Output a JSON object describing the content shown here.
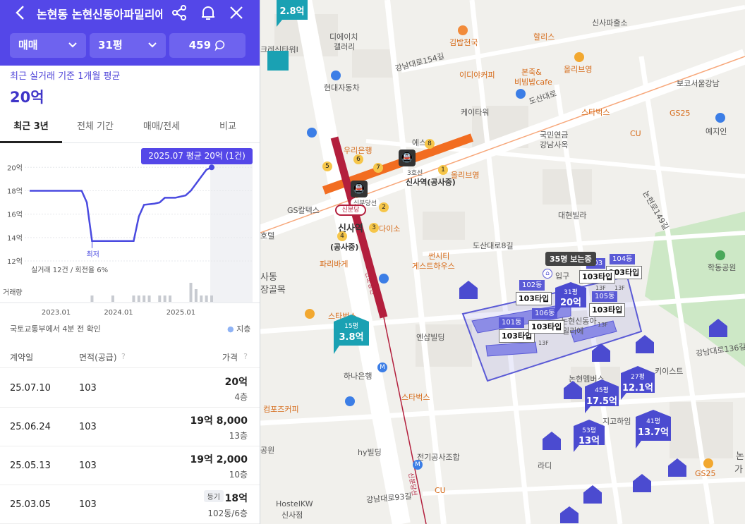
{
  "header": {
    "title": "논현동 논현신동아파밀리에",
    "back_icon": "chevron-left-icon",
    "share_icon": "share-icon",
    "alarm_icon": "bell-icon",
    "close_icon": "close-icon"
  },
  "filters": {
    "trade": "매매",
    "size": "31평",
    "comments": "459"
  },
  "summary": {
    "caption": "최근 실거래 기준 1개월 평균",
    "value": "20억"
  },
  "tabs": [
    "최근 3년",
    "전체 기간",
    "매매/전세",
    "비교"
  ],
  "chart_data": {
    "type": "line",
    "tooltip": "2025.07 평균 20억 (1건)",
    "ylabels": [
      "20억",
      "18억",
      "16억",
      "14억",
      "12억"
    ],
    "ylim": [
      12,
      20.8
    ],
    "xlabels": [
      "2023.01",
      "2024.01",
      "2025.01"
    ],
    "min_label": "최저",
    "caption": "실거래 12건 / 회전율 6%",
    "volume_label": "거래량",
    "series": [
      {
        "values": [
          [
            "2022-08",
            18
          ],
          [
            "2022-10",
            18
          ],
          [
            "2022-12",
            18
          ],
          [
            "2023-02",
            18
          ],
          [
            "2023-04",
            18
          ],
          [
            "2023-06",
            18
          ],
          [
            "2023-07",
            17
          ],
          [
            "2023-08",
            13.7
          ],
          [
            "2023-10",
            13.7
          ],
          [
            "2023-12",
            13.7
          ],
          [
            "2024-02",
            13.7
          ],
          [
            "2024-04",
            13.7
          ],
          [
            "2024-05",
            15.8
          ],
          [
            "2024-06",
            16.8
          ],
          [
            "2024-08",
            16.9
          ],
          [
            "2024-09",
            17
          ],
          [
            "2024-10",
            17.4
          ],
          [
            "2024-12",
            17.4
          ],
          [
            "2025-02",
            17.6
          ],
          [
            "2025-03",
            18
          ],
          [
            "2025-04",
            18.6
          ],
          [
            "2025-05",
            19.2
          ],
          [
            "2025-06",
            19.8
          ],
          [
            "2025-07",
            20
          ]
        ]
      }
    ],
    "volume": [
      [
        "2023-08",
        1
      ],
      [
        "2023-12",
        1
      ],
      [
        "2024-04",
        1
      ],
      [
        "2024-05",
        1
      ],
      [
        "2024-06",
        1
      ],
      [
        "2024-07",
        1
      ],
      [
        "2024-09",
        1
      ],
      [
        "2024-10",
        1
      ],
      [
        "2024-11",
        1
      ],
      [
        "2025-03",
        3
      ],
      [
        "2025-04",
        2
      ],
      [
        "2025-05",
        1
      ],
      [
        "2025-06",
        1
      ],
      [
        "2025-07",
        1
      ]
    ]
  },
  "notice": {
    "source": "국토교통부에서 4분 전 확인",
    "legend": "지층"
  },
  "table": {
    "headers": [
      "계약일",
      "면적(공급)",
      "가격"
    ],
    "rows": [
      {
        "date": "25.07.10",
        "area": "103",
        "price": "20억",
        "floor": "4층",
        "badge": ""
      },
      {
        "date": "25.06.24",
        "area": "103",
        "price": "19억 8,000",
        "floor": "13층",
        "badge": ""
      },
      {
        "date": "25.05.13",
        "area": "103",
        "price": "19억 2,000",
        "floor": "10층",
        "badge": ""
      },
      {
        "date": "25.03.05",
        "area": "103",
        "price": "18억",
        "floor": "102동/6층",
        "badge": "등기"
      }
    ]
  },
  "map": {
    "labels": [
      {
        "t": "신사파출소"
      },
      {
        "t": "크레신타워I"
      },
      {
        "t": "디에이치"
      },
      {
        "t": "갤러리"
      },
      {
        "t": "김밥천국"
      },
      {
        "t": "할리스"
      },
      {
        "t": "강남대로154길"
      },
      {
        "t": "올리브영"
      },
      {
        "t": "이디야커피"
      },
      {
        "t": "본죽&"
      },
      {
        "t": "비빔밥cafe"
      },
      {
        "t": "보코서울강남"
      },
      {
        "t": "현대자동차"
      },
      {
        "t": "도산대로"
      },
      {
        "t": "케이타워"
      },
      {
        "t": "스타벅스"
      },
      {
        "t": "GS25"
      },
      {
        "t": "예지인"
      },
      {
        "t": "CU"
      },
      {
        "t": "우리은행"
      },
      {
        "t": "에스"
      },
      {
        "t": "국민연금"
      },
      {
        "t": "강남사옥"
      },
      {
        "t": "3호선"
      },
      {
        "t": "신사역(공사중)"
      },
      {
        "t": "신분당선"
      },
      {
        "t": "신사역"
      },
      {
        "t": "올리브영"
      },
      {
        "t": "GS칼텍스"
      },
      {
        "t": "대현빌라"
      },
      {
        "t": "다이소"
      },
      {
        "t": "호텔"
      },
      {
        "t": "(공사중)"
      },
      {
        "t": "파리바게"
      },
      {
        "t": "논현로149길"
      },
      {
        "t": "학동공원"
      },
      {
        "t": "도산대로8길"
      },
      {
        "t": "썬시티"
      },
      {
        "t": "게스트하우스"
      },
      {
        "t": "사동"
      },
      {
        "t": "장골목"
      },
      {
        "t": "스타벅스"
      },
      {
        "t": "엔샵빌딩"
      },
      {
        "t": "키이스트"
      },
      {
        "t": "강남대로136길"
      },
      {
        "t": "하나은행"
      },
      {
        "t": "논현멤버스"
      },
      {
        "t": "지고하임"
      },
      {
        "t": "컴포즈커피"
      },
      {
        "t": "스타벅스"
      },
      {
        "t": "hy빌딩"
      },
      {
        "t": "전기공사조합"
      },
      {
        "t": "공원"
      },
      {
        "t": "CU"
      },
      {
        "t": "HostelKW"
      },
      {
        "t": "신사점"
      },
      {
        "t": "강남대로93길"
      },
      {
        "t": "라디"
      },
      {
        "t": "GS25"
      },
      {
        "t": "논"
      },
      {
        "t": "가"
      },
      {
        "t": "신분당선"
      },
      {
        "t": "신분당선"
      },
      {
        "t": "심라",
        "note": "partial"
      },
      {
        "t": "입구"
      },
      {
        "t": "논현신동아"
      },
      {
        "t": "밀리에"
      }
    ],
    "tooltip35": "35명 보는중",
    "dong_tags": [
      {
        "head": "102동",
        "type": "103타입"
      },
      {
        "head": "101동",
        "type": "103타입"
      },
      {
        "head": "106동",
        "type": "103타입"
      },
      {
        "head": "105동",
        "type": "103타입"
      },
      {
        "head": "104동",
        "type": "103타입"
      },
      {
        "head": "103",
        "type": "103타입"
      }
    ],
    "main_marker": {
      "size": "31평",
      "price": "20억"
    },
    "price_markers": [
      {
        "size": "45평",
        "price": "17.5억"
      },
      {
        "size": "27평",
        "price": "12.1억"
      },
      {
        "size": "41평",
        "price": "13.7억"
      },
      {
        "size": "53평",
        "price": "13억"
      },
      {
        "size": "15평",
        "price": "3.8억"
      },
      {
        "size": "",
        "price": "2.8억"
      }
    ],
    "numbers": [
      "1",
      "2",
      "3",
      "4",
      "5",
      "6",
      "7",
      "8"
    ],
    "floor_marks": [
      "13F",
      "13F",
      "13F",
      "13F"
    ]
  },
  "colors": {
    "brand": "#5447e8",
    "line": "#4a4ae0",
    "teal": "#1aa1b3",
    "markerDark": "#4b4bd0",
    "subway3": "#f26d21",
    "subwayShinbundang": "#b31f3d"
  }
}
